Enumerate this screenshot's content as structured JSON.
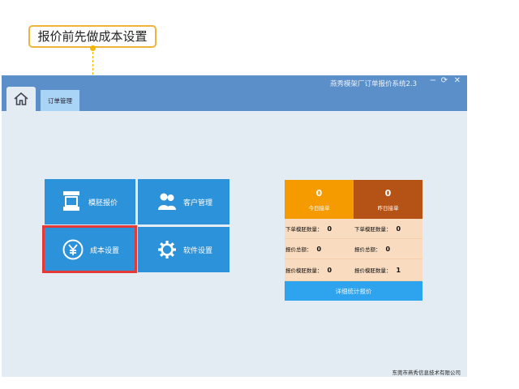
{
  "callout": {
    "text": "报价前先做成本设置"
  },
  "window": {
    "title": "燕秀模架厂订单报价系统2.3",
    "minimize": "−",
    "restore": "⟳",
    "close": "✕"
  },
  "tabs": {
    "order_management": "订单管理"
  },
  "tiles": [
    {
      "label": "模胚报价",
      "icon": "mold-icon"
    },
    {
      "label": "客户管理",
      "icon": "users-icon"
    },
    {
      "label": "成本设置",
      "icon": "yen-icon"
    },
    {
      "label": "软件设置",
      "icon": "gear-icon"
    }
  ],
  "stats": {
    "today": {
      "value": "0",
      "label": "今日接单",
      "color": "#f59b00"
    },
    "yesterday": {
      "value": "0",
      "label": "昨日接单",
      "color": "#b55317"
    },
    "rows": [
      {
        "left_label": "下单模胚数量：",
        "left_value": "0",
        "right_label": "下单模胚数量：",
        "right_value": "0"
      },
      {
        "left_label": "报价总额：",
        "left_value": "0",
        "right_label": "报价总额：",
        "right_value": "0"
      },
      {
        "left_label": "报价模胚数量：",
        "left_value": "0",
        "right_label": "报价模胚数量：",
        "right_value": "1"
      }
    ],
    "detail_button": "详细统计报价"
  },
  "footer": {
    "company": "东莞市燕秀信息技术有限公司"
  },
  "colors": {
    "accent": "#2c92d9",
    "titlebar": "#5b8fc9",
    "highlight": "#e53935",
    "callout_border": "#f0b43a"
  }
}
